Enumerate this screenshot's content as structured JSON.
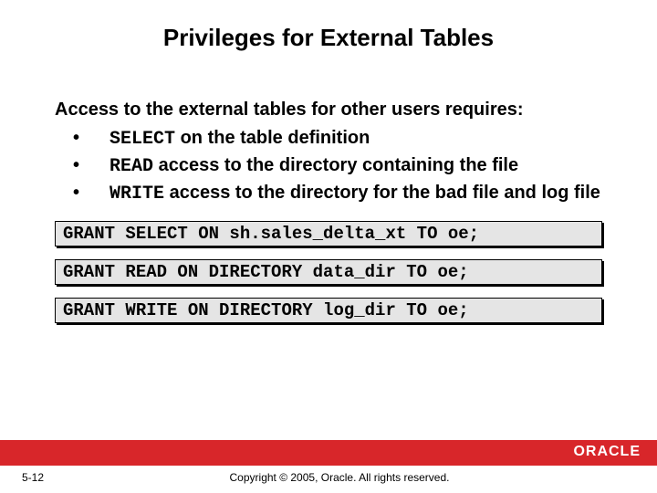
{
  "title": "Privileges for External Tables",
  "intro": "Access to the external tables for other users requires:",
  "bullets": {
    "b1": {
      "kw": "SELECT",
      "rest": " on the table definition"
    },
    "b2": {
      "kw": "READ",
      "rest": " access to the directory containing the file"
    },
    "b3": {
      "kw": "WRITE",
      "rest": " access to the directory for the bad file and log file"
    }
  },
  "code": {
    "c1": "GRANT SELECT ON sh.sales_delta_xt TO oe;",
    "c2": "GRANT READ ON DIRECTORY data_dir TO oe;",
    "c3": "GRANT WRITE ON DIRECTORY log_dir TO oe;"
  },
  "footer": {
    "page": "5-12",
    "copyright": "Copyright © 2005, Oracle. All rights reserved.",
    "logo": "ORACLE"
  }
}
